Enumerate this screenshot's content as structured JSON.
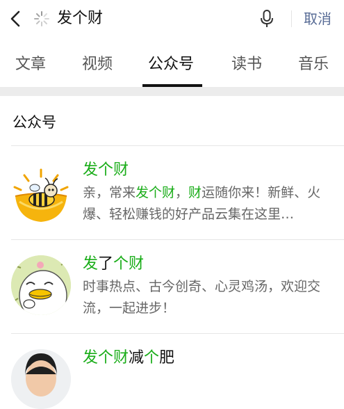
{
  "search": {
    "query": "发个财",
    "cancel_label": "取消"
  },
  "tabs": [
    {
      "label": "文章",
      "active": false
    },
    {
      "label": "视频",
      "active": false
    },
    {
      "label": "公众号",
      "active": true
    },
    {
      "label": "读书",
      "active": false
    },
    {
      "label": "音乐",
      "active": false
    }
  ],
  "section": {
    "title": "公众号"
  },
  "results": [
    {
      "title_parts": [
        {
          "text": "发个财",
          "hl": true
        }
      ],
      "desc_parts": [
        {
          "text": "亲，常来",
          "hl": false
        },
        {
          "text": "发个财",
          "hl": true
        },
        {
          "text": "，",
          "hl": false
        },
        {
          "text": "财",
          "hl": true
        },
        {
          "text": "运随你来！新鲜、火爆、轻松赚钱的好产品云集在这里…",
          "hl": false
        }
      ]
    },
    {
      "title_parts": [
        {
          "text": "发",
          "hl": true
        },
        {
          "text": "了",
          "hl": false
        },
        {
          "text": "个财",
          "hl": true
        }
      ],
      "desc_parts": [
        {
          "text": "时事热点、古今创奇、心灵鸡汤，欢迎交流，一起进步！",
          "hl": false
        }
      ]
    },
    {
      "title_parts": [
        {
          "text": "发个财",
          "hl": true
        },
        {
          "text": "减",
          "hl": false
        },
        {
          "text": "个",
          "hl": true
        },
        {
          "text": "肥",
          "hl": false
        }
      ],
      "desc_parts": []
    }
  ],
  "colors": {
    "highlight": "#1aad19",
    "cancel_link": "#576b95",
    "separator_band": "#ececec"
  }
}
